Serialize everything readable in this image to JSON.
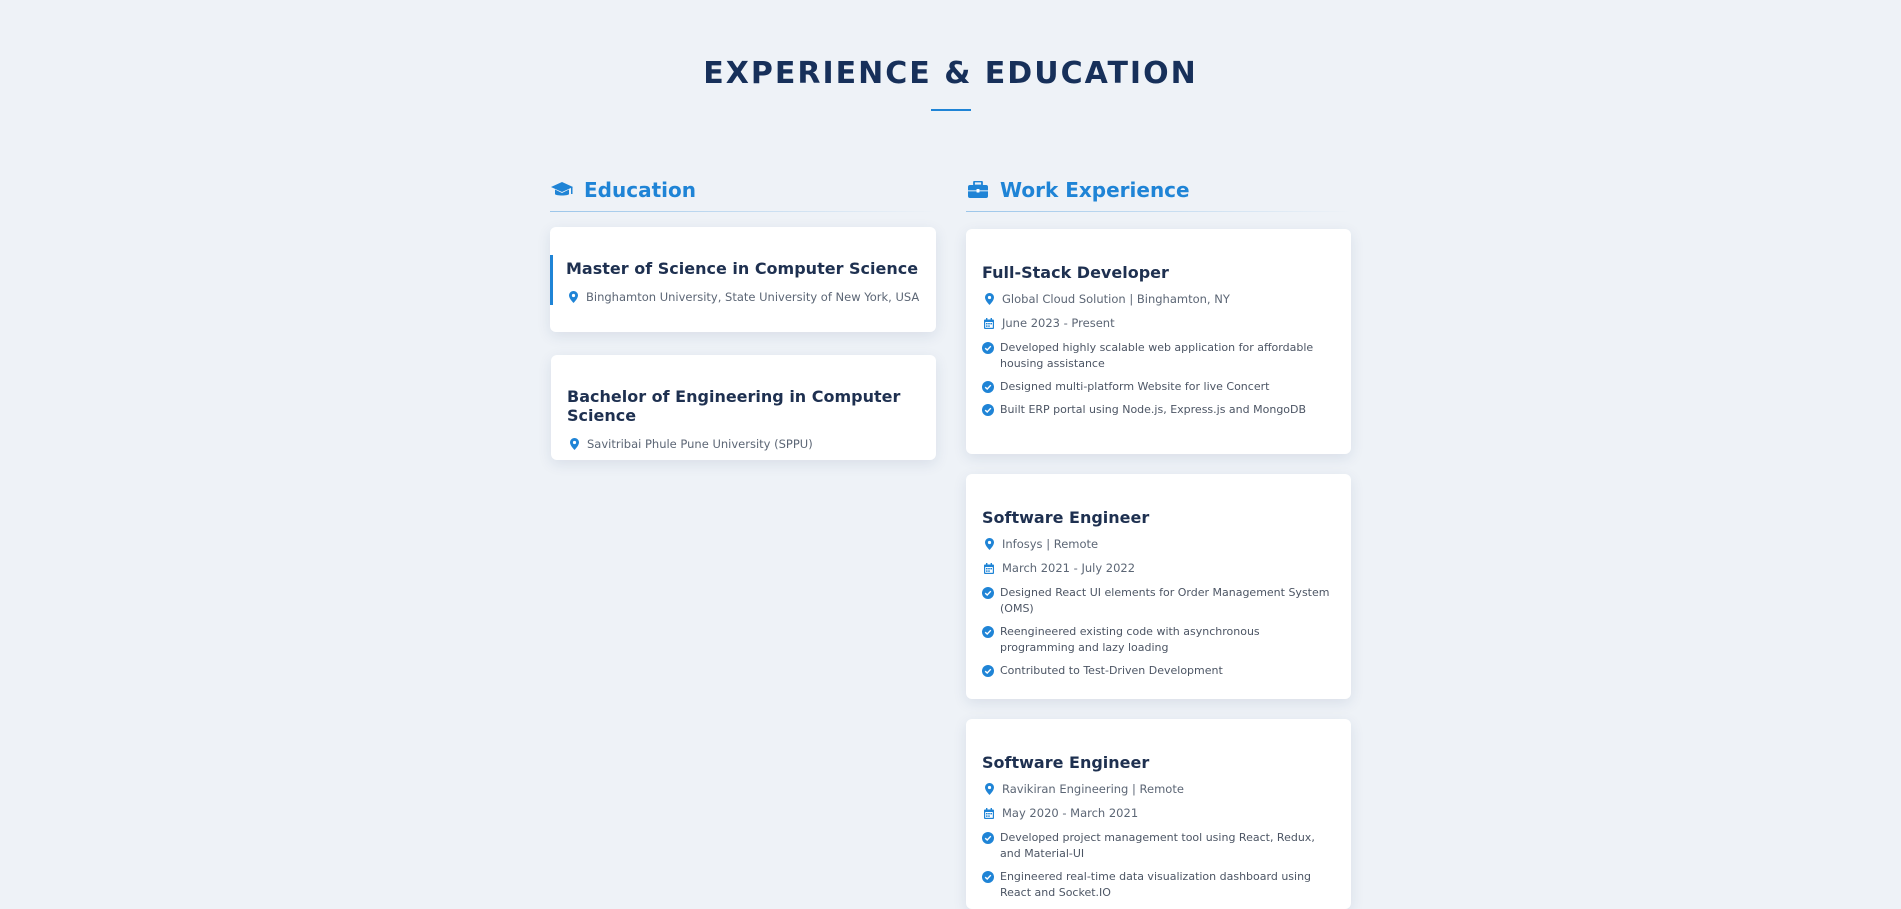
{
  "section": {
    "title": "EXPERIENCE & EDUCATION"
  },
  "education": {
    "heading": "Education",
    "icon": "graduation-cap-icon",
    "items": [
      {
        "degree": "Master of Science in Computer Science",
        "school": "Binghamton University, State University of New York, USA"
      },
      {
        "degree": "Bachelor of Engineering in Computer Science",
        "school": "Savitribai Phule Pune University (SPPU)"
      }
    ]
  },
  "work": {
    "heading": "Work Experience",
    "icon": "briefcase-icon",
    "items": [
      {
        "role": "Full-Stack Developer",
        "company": "Global Cloud Solution | Binghamton, NY",
        "dates": "June 2023 - Present",
        "bullets": [
          "Developed highly scalable web application for affordable housing assistance",
          "Designed multi-platform Website for live Concert",
          "Built ERP portal using Node.js, Express.js and MongoDB"
        ]
      },
      {
        "role": "Software Engineer",
        "company": "Infosys | Remote",
        "dates": "March 2021 - July 2022",
        "bullets": [
          "Designed React UI elements for Order Management System (OMS)",
          "Reengineered existing code with asynchronous programming and lazy loading",
          "Contributed to Test-Driven Development"
        ]
      },
      {
        "role": "Software Engineer",
        "company": "Ravikiran Engineering | Remote",
        "dates": "May 2020 - March 2021",
        "bullets": [
          "Developed project management tool using React, Redux, and Material-UI",
          "Engineered real-time data visualization dashboard using React and Socket.IO"
        ]
      }
    ]
  },
  "colors": {
    "accent": "#1f84d6",
    "title": "#17305a",
    "background": "#eef2f7",
    "card": "#ffffff"
  }
}
